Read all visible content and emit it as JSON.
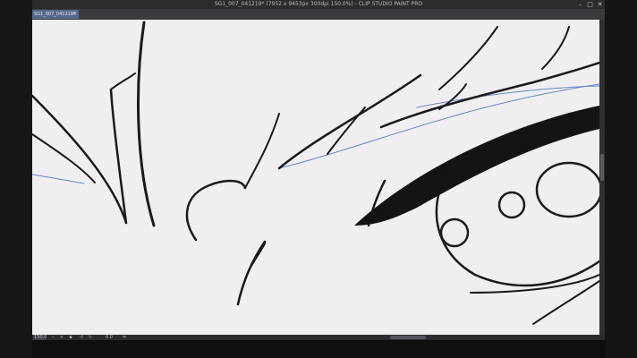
{
  "window": {
    "title": "SG1_007_041219* (7952 x 9453px 300dpi 150.0%)  - CLIP STUDIO PAINT PRO",
    "controls": {
      "minimize": "–",
      "maximize": "□",
      "close": "✕"
    }
  },
  "tabs": [
    {
      "label": "SG1_007_041219*",
      "close": "×",
      "active": true
    }
  ],
  "statusbar": {
    "zoom": "150.0",
    "angle": "0.0"
  },
  "colors": {
    "canvas": "#efeef0",
    "ink": "#1a1a1a",
    "guide": "#6b86c9",
    "tab_active": "#56688a"
  },
  "icons": {
    "status": [
      "zoom-out-icon",
      "zoom-in-icon",
      "fit-icon",
      "rotate-left-icon",
      "rotate-right-icon",
      "flip-icon"
    ]
  }
}
